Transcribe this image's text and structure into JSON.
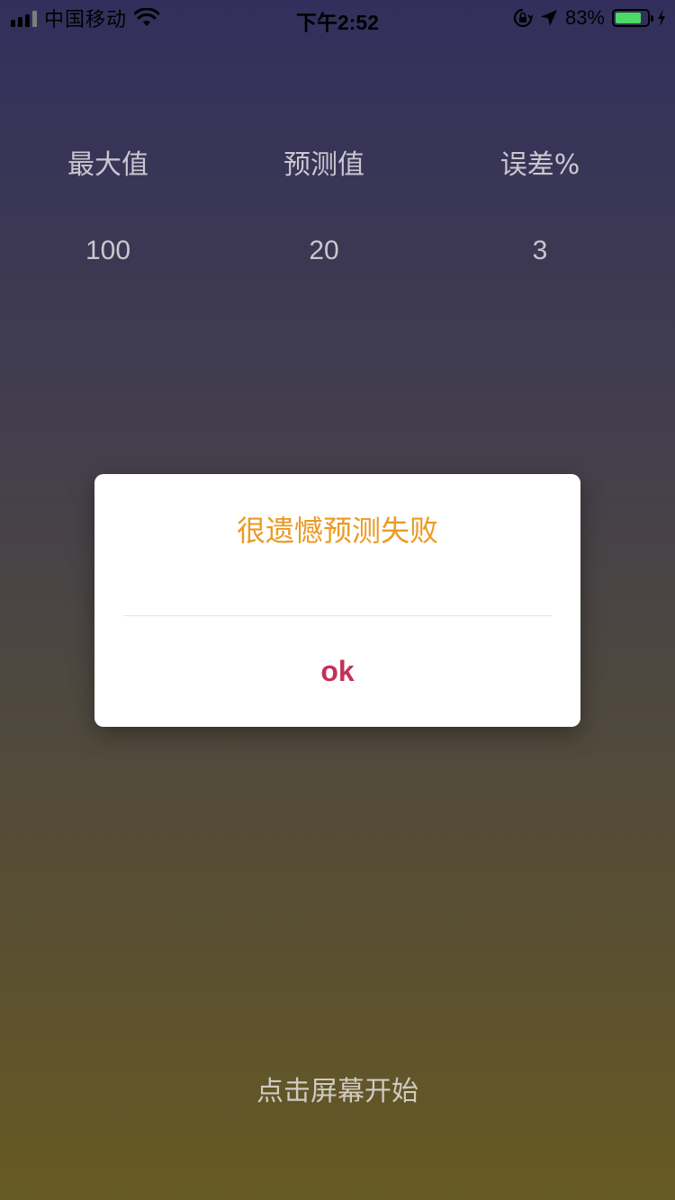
{
  "status_bar": {
    "carrier": "中国移动",
    "time": "下午2:52",
    "battery_percent": "83%",
    "battery_level": 0.83,
    "icons": [
      "signal-icon",
      "wifi-icon",
      "orientation-lock-icon",
      "location-arrow-icon",
      "battery-icon",
      "charging-bolt-icon"
    ]
  },
  "stats": {
    "headers": [
      "最大值",
      "预测值",
      "误差%"
    ],
    "values": [
      "100",
      "20",
      "3"
    ]
  },
  "dialog": {
    "title": "很遗憾预测失败",
    "ok_label": "ok",
    "title_color": "#eb9a22",
    "ok_color": "#c2305b"
  },
  "start_hint": "点击屏幕开始"
}
